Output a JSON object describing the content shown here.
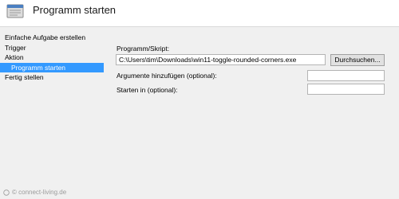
{
  "window": {
    "title": "Programm starten"
  },
  "nav": {
    "items": [
      {
        "label": "Einfache Aufgabe erstellen",
        "selected": false,
        "sub": false
      },
      {
        "label": "Trigger",
        "selected": false,
        "sub": false
      },
      {
        "label": "Aktion",
        "selected": false,
        "sub": false
      },
      {
        "label": "Programm starten",
        "selected": true,
        "sub": true
      },
      {
        "label": "Fertig stellen",
        "selected": false,
        "sub": false
      }
    ]
  },
  "form": {
    "program_label": "Programm/Skript:",
    "program_value": "C:\\Users\\tim\\Downloads\\win11-toggle-rounded-corners.exe",
    "browse_label": "Durchsuchen...",
    "args_label": "Argumente hinzufügen (optional):",
    "args_value": "",
    "startin_label": "Starten in (optional):",
    "startin_value": ""
  },
  "watermark": {
    "text": "© connect-living.de"
  },
  "colors": {
    "selection": "#3399ff",
    "header_bg": "#ffffff",
    "body_bg": "#f0f0f0"
  }
}
